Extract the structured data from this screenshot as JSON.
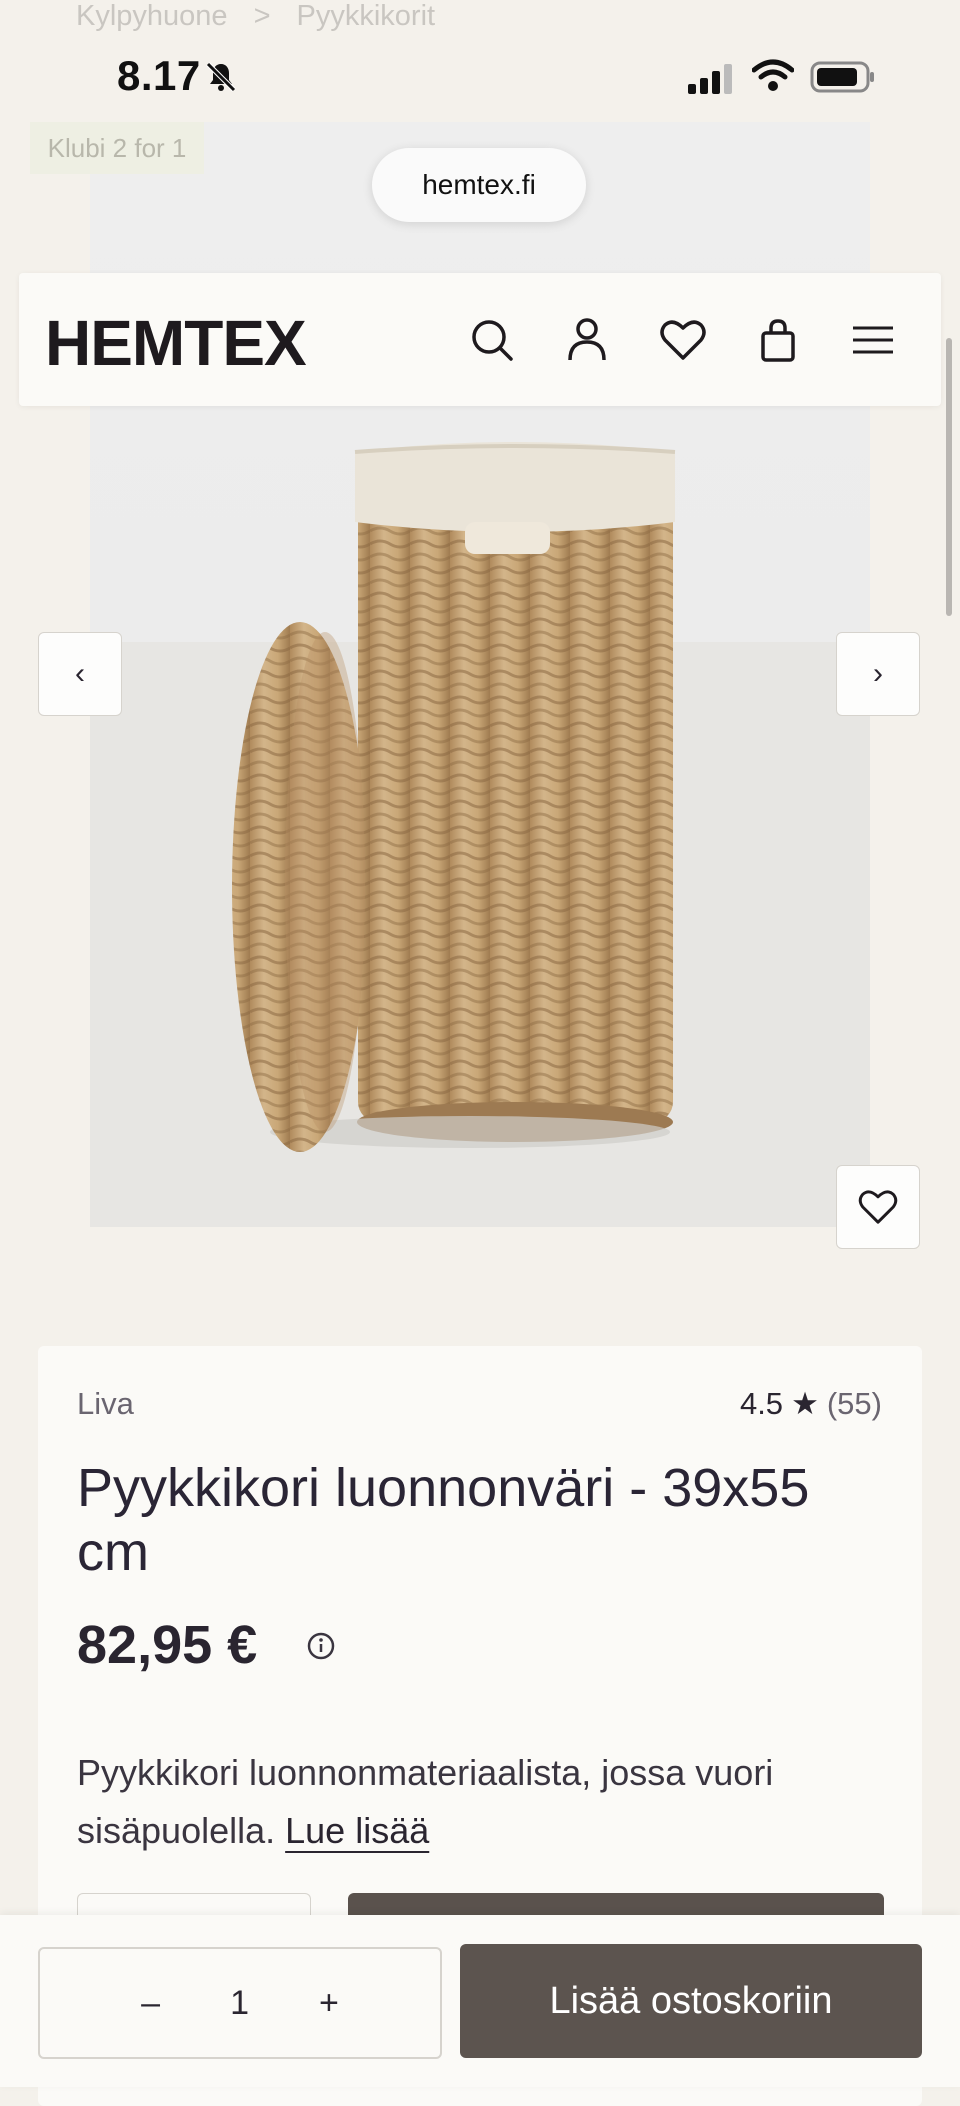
{
  "breadcrumb": {
    "items": [
      "Kylpyhuone",
      ">",
      "Pyykkikorit"
    ]
  },
  "status_bar": {
    "time": "8.17"
  },
  "promo": {
    "badge": "Klubi 2 for 1"
  },
  "browser": {
    "url": "hemtex.fi"
  },
  "header": {
    "logo": "HEMTEX",
    "icons": [
      "search-icon",
      "account-icon",
      "wishlist-icon",
      "bag-icon",
      "menu-icon"
    ]
  },
  "carousel": {
    "prev": "‹",
    "next": "›"
  },
  "product": {
    "brand": "Liva",
    "rating_value": "4.5",
    "rating_star": "★",
    "rating_count": "(55)",
    "title": "Pyykkikori luonnonväri - 39x55 cm",
    "price": "82,95 €",
    "description": "Pyykkikori luonnonmateriaalista, jossa vuori sisäpuolella.",
    "read_more": "Lue lisää"
  },
  "cart": {
    "minus": "–",
    "quantity": "1",
    "plus": "+",
    "add_label": "Lisää ostoskoriin"
  },
  "colors": {
    "background": "#f4f1eb",
    "card": "#fbfaf7",
    "primary_button": "#5c544f",
    "text": "#2a2530"
  }
}
